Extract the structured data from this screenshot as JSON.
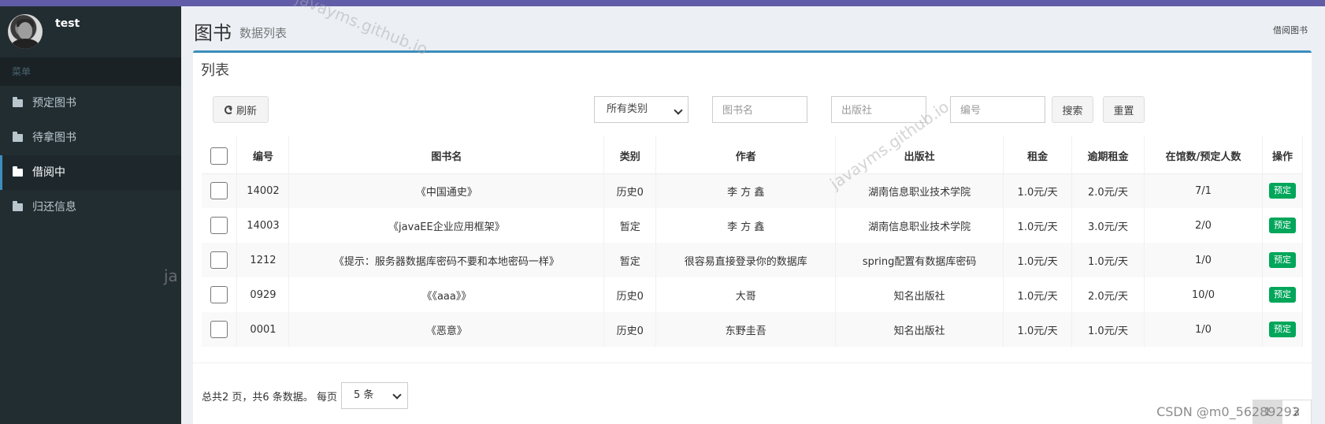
{
  "sidebar": {
    "username": "test",
    "menu_header": "菜单",
    "items": [
      {
        "label": "预定图书"
      },
      {
        "label": "待拿图书"
      },
      {
        "label": "借阅中"
      },
      {
        "label": "归还信息"
      }
    ],
    "active_index": 2
  },
  "header": {
    "title": "图书",
    "subtitle": "数据列表",
    "breadcrumb": "借阅图书"
  },
  "box": {
    "title": "列表"
  },
  "toolbar": {
    "refresh_label": "刷新",
    "category_value": "所有类别",
    "name_placeholder": "图书名",
    "publisher_placeholder": "出版社",
    "id_placeholder": "编号",
    "search_label": "搜索",
    "reset_label": "重置"
  },
  "table": {
    "headers": [
      "编号",
      "图书名",
      "类别",
      "作者",
      "出版社",
      "租金",
      "逾期租金",
      "在馆数/预定人数",
      "操作"
    ],
    "rows": [
      {
        "id": "14002",
        "name": "《中国通史》",
        "category": "历史0",
        "author": "李 方 鑫",
        "publisher": "湖南信息职业技术学院",
        "rent": "1.0元/天",
        "late_fee": "2.0元/天",
        "count": "7/1",
        "action": "预定"
      },
      {
        "id": "14003",
        "name": "《javaEE企业应用框架》",
        "category": "暂定",
        "author": "李 方 鑫",
        "publisher": "湖南信息职业技术学院",
        "rent": "1.0元/天",
        "late_fee": "3.0元/天",
        "count": "2/0",
        "action": "预定"
      },
      {
        "id": "1212",
        "name": "《提示：服务器数据库密码不要和本地密码一样》",
        "category": "暂定",
        "author": "很容易直接登录你的数据库",
        "publisher": "spring配置有数据库密码",
        "rent": "1.0元/天",
        "late_fee": "1.0元/天",
        "count": "1/0",
        "action": "预定"
      },
      {
        "id": "0929",
        "name": "《《aaa》》",
        "category": "历史0",
        "author": "大哥",
        "publisher": "知名出版社",
        "rent": "1.0元/天",
        "late_fee": "2.0元/天",
        "count": "10/0",
        "action": "预定"
      },
      {
        "id": "0001",
        "name": "《恶意》",
        "category": "历史0",
        "author": "东野圭吾",
        "publisher": "知名出版社",
        "rent": "1.0元/天",
        "late_fee": "1.0元/天",
        "count": "1/0",
        "action": "预定"
      }
    ]
  },
  "pagination": {
    "summary": "总共2 页，共6 条数据。 每页",
    "page_size": "5 条",
    "pages": [
      "1",
      "2"
    ],
    "current_page": "1"
  },
  "watermarks": [
    "javayms.github.io",
    "javayms.github.io",
    "ja"
  ],
  "csdn_mark": "CSDN @m0_56289293",
  "colors": {
    "topbar": "#605ca8",
    "sidebar": "#222d32",
    "accent": "#3c8dbc",
    "badge": "#00a65a"
  }
}
